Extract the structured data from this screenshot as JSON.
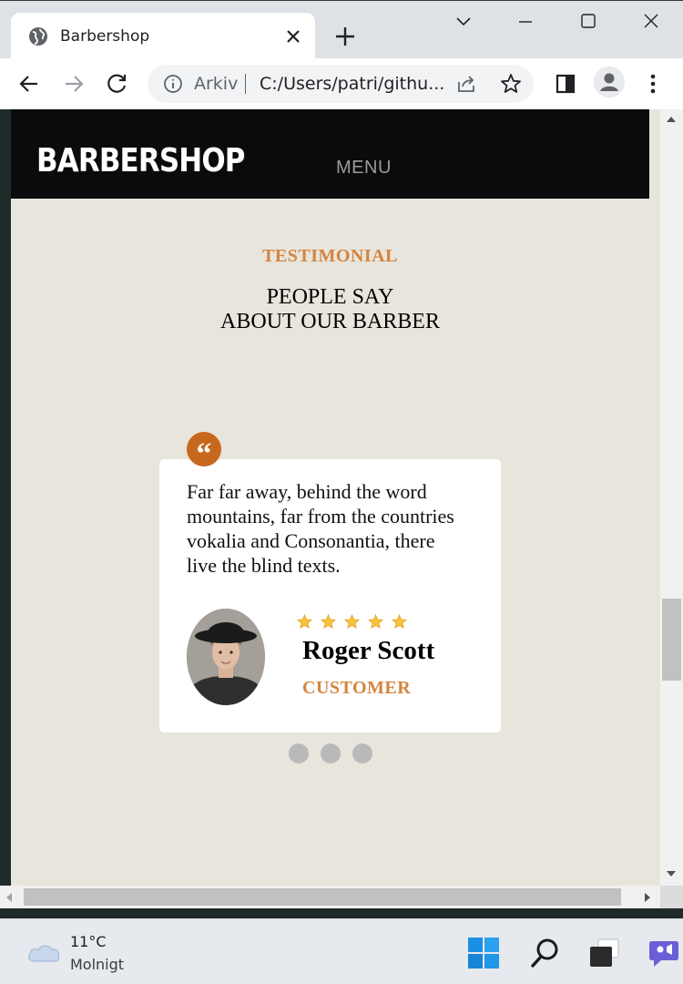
{
  "browser": {
    "tab_title": "Barbershop",
    "omnibox_label": "Arkiv",
    "url": "C:/Users/patri/githu..."
  },
  "site": {
    "logo": "BARBERSHOP",
    "menu": "MENU",
    "eyebrow": "TESTIMONIAL",
    "heading_line1": "PEOPLE SAY",
    "heading_line2": "ABOUT OUR BARBER",
    "testimonial": {
      "text": "Far far away, behind the word mountains, far from the countries vokalia and Consonantia, there live the blind texts.",
      "rating": 5,
      "name": "Roger Scott",
      "role": "CUSTOMER"
    },
    "slider_dots": 3,
    "colors": {
      "accent": "#d4843f",
      "badge": "#c8671e",
      "header": "#0b0b0b",
      "background": "#e8e5dc"
    }
  },
  "taskbar": {
    "temperature": "11°C",
    "condition": "Molnigt"
  }
}
